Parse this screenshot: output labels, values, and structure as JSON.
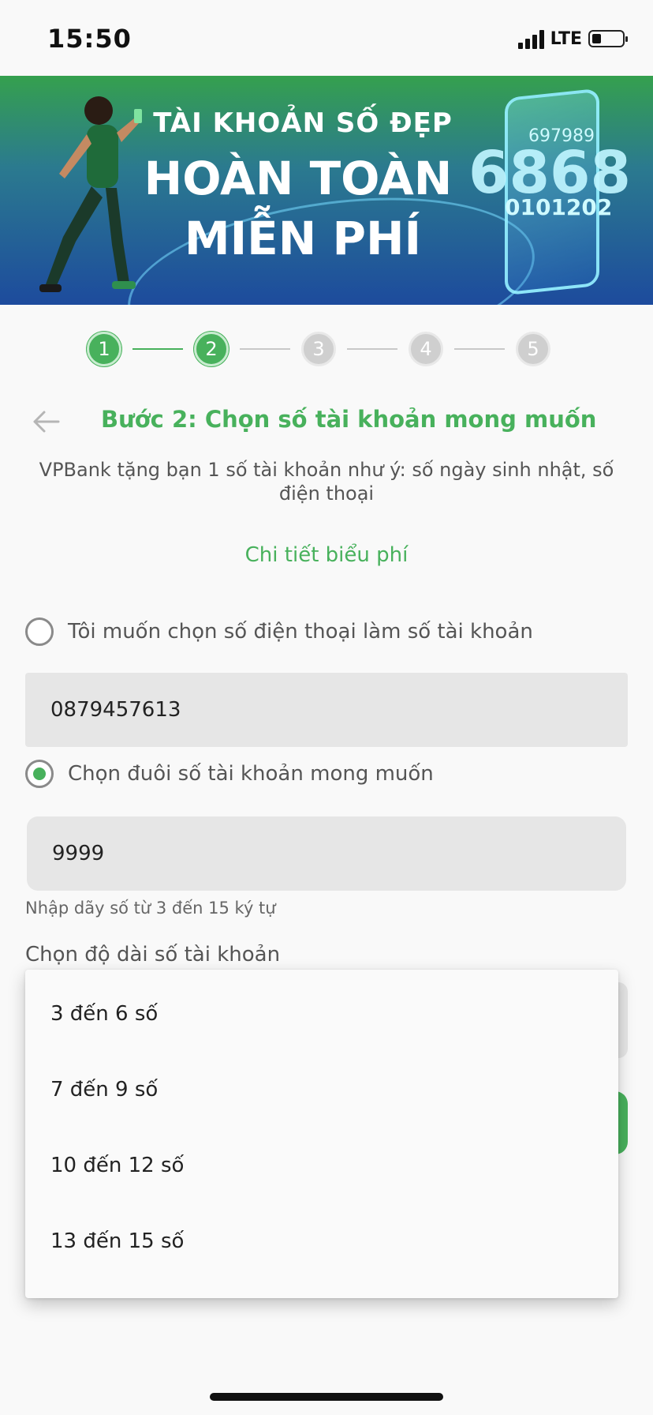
{
  "status_bar": {
    "time": "15:50",
    "network": "LTE",
    "battery_level": 0.3
  },
  "banner": {
    "line1": "TÀI KHOẢN SỐ ĐẸP",
    "line2": "HOÀN TOÀN",
    "line3": "MIỄN PHÍ",
    "digits_large": "6868",
    "digits_small_top": "697989",
    "digits_small_mid": "0101202"
  },
  "stepper": {
    "steps": [
      "1",
      "2",
      "3",
      "4",
      "5"
    ],
    "current_step": 2,
    "active_color": "#48b15c",
    "inactive_color": "#cfcfcf"
  },
  "page": {
    "title": "Bước 2: Chọn số tài khoản mong muốn",
    "description": "VPBank tặng bạn 1 số tài khoản như ý: số ngày sinh nhật, số điện thoại",
    "fee_link": "Chi tiết biểu phí"
  },
  "options": {
    "phone_option_label": "Tôi muốn chọn số điện thoại làm số tài khoản",
    "phone_value": "0879457613",
    "phone_selected": false,
    "suffix_option_label": "Chọn đuôi số tài khoản mong muốn",
    "suffix_value": "9999",
    "suffix_selected": true,
    "suffix_helper": "Nhập dãy số từ 3 đến 15 ký tự",
    "length_label": "Chọn độ dài số tài khoản"
  },
  "dropdown": {
    "items": [
      "3 đến 6 số",
      "7 đến 9 số",
      "10 đến 12 số",
      "13 đến 15 số"
    ]
  },
  "colors": {
    "brand_green": "#48b15c",
    "field_bg": "#e6e6e6"
  }
}
